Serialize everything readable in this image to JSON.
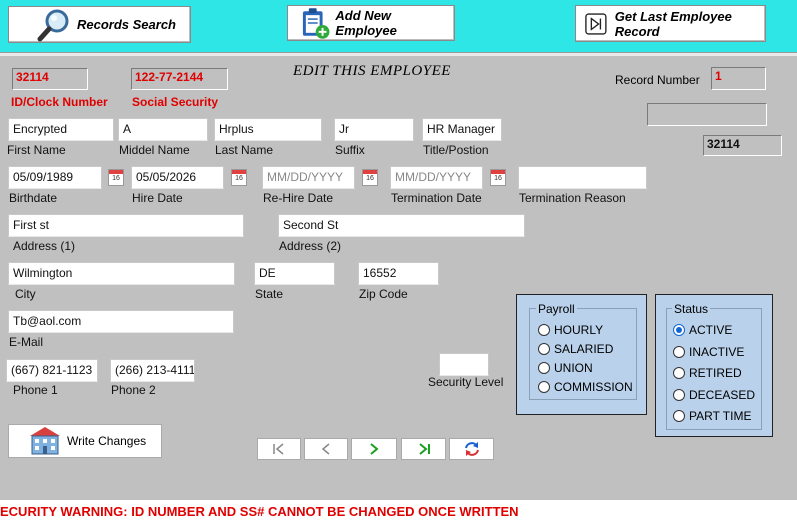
{
  "toolbar": {
    "records_search": "Records Search",
    "add_new_employee": "Add New Employee",
    "get_last_record": "Get Last Employee Record"
  },
  "form": {
    "title": "EDIT THIS EMPLOYEE",
    "id_value": "32114",
    "id_label": "ID/Clock Number",
    "ssn_value": "122-77-2144",
    "ssn_label": "Social Security",
    "record_number_label": "Record Number",
    "record_number_value": "1",
    "blank_box_value": "",
    "id_echo": "32114"
  },
  "fields": {
    "first_name": {
      "value": "Encrypted",
      "label": "First Name"
    },
    "middle_name": {
      "value": "A",
      "label": "Middel Name"
    },
    "last_name": {
      "value": "Hrplus",
      "label": "Last Name"
    },
    "suffix": {
      "value": "Jr",
      "label": "Suffix"
    },
    "title": {
      "value": "HR Manager",
      "label": "Title/Postion"
    },
    "birthdate": {
      "value": "05/09/1989",
      "label": "Birthdate"
    },
    "hire_date": {
      "value": "05/05/2026",
      "label": "Hire Date"
    },
    "rehire_date": {
      "placeholder": "MM/DD/YYYY",
      "label": "Re-Hire Date"
    },
    "termination_date": {
      "placeholder": "MM/DD/YYYY",
      "label": "Termination Date"
    },
    "termination_reason": {
      "value": "",
      "label": "Termination Reason"
    },
    "address1": {
      "value": "First st",
      "label": "Address (1)"
    },
    "address2": {
      "value": "Second St",
      "label": "Address (2)"
    },
    "city": {
      "value": "Wilmington",
      "label": "City"
    },
    "state": {
      "value": "DE",
      "label": "State"
    },
    "zip": {
      "value": "16552",
      "label": "Zip Code"
    },
    "email": {
      "value": "Tb@aol.com",
      "label": "E-Mail"
    },
    "phone1": {
      "value": "(667) 821-1123",
      "label": "Phone 1"
    },
    "phone2": {
      "value": "(266) 213-4111",
      "label": "Phone 2"
    },
    "security_level": {
      "value": "",
      "label": "Security Level"
    }
  },
  "calendar_icon_text": "16",
  "payroll": {
    "title": "Payroll",
    "options": [
      "HOURLY",
      "SALARIED",
      "UNION",
      "COMMISSION"
    ],
    "selected": null
  },
  "status": {
    "title": "Status",
    "options": [
      "ACTIVE",
      "INACTIVE",
      "RETIRED",
      "DECEASED",
      "PART TIME"
    ],
    "selected": "ACTIVE"
  },
  "write_changes": "Write Changes",
  "warning": "ECURITY WARNING:  ID NUMBER AND SS# CANNOT BE CHANGED ONCE WRITTEN",
  "colors": {
    "toolbar_bg": "#2ee6e6",
    "warning_red": "#e00000",
    "group_bg": "#b9d1ea",
    "radio_selected": "#1066d6",
    "nav_green": "#1aa020",
    "refresh_blue": "#1a5fd0"
  }
}
